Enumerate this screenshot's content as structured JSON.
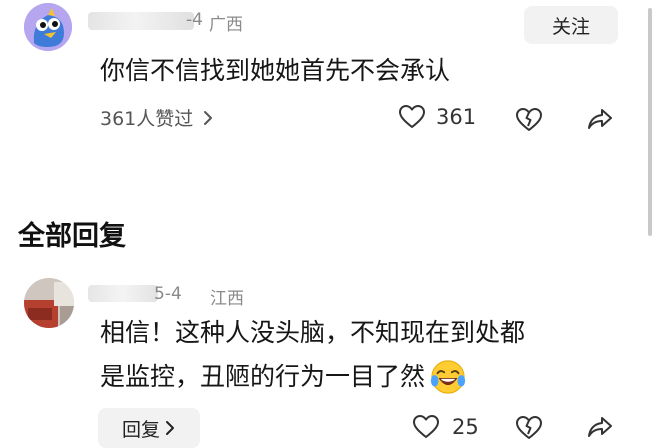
{
  "comment1": {
    "name_tail": "-4",
    "location": "广西",
    "follow_label": "关注",
    "text": "你信不信找到她她首先不会承认",
    "likes_link": "361人赞过",
    "like_count": "361",
    "icons": [
      "robot-bird-avatar",
      "heart-icon",
      "broken-heart-icon",
      "share-icon",
      "chevron-right-icon"
    ]
  },
  "section": {
    "title": "全部回复"
  },
  "reply1": {
    "date": "5-4",
    "location": "江西",
    "text_line1": "相信！这种人没头脑，不知现在到处都",
    "text_line2": "是监控，丑陋的行为一目了然",
    "reply_label": "回复",
    "like_count": "25",
    "emoji": "laughing-crying-emoji"
  },
  "colors": {
    "follow_bg": "#f2f2f2",
    "meta_gray": "#8a8a8a",
    "avatar_purple": "#b7a7f0"
  }
}
